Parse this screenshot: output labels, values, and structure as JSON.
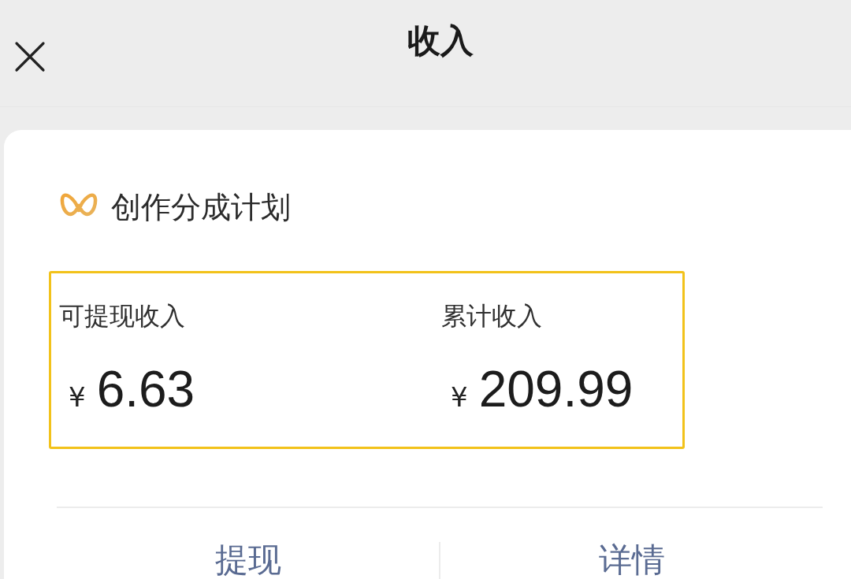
{
  "header": {
    "title": "收入"
  },
  "program": {
    "name": "创作分成计划"
  },
  "earnings": {
    "highlighted": true,
    "items": [
      {
        "label": "可提现收入",
        "currency": "¥",
        "amount": "6.63"
      },
      {
        "label": "累计收入",
        "currency": "¥",
        "amount": "209.99"
      }
    ]
  },
  "actions": [
    "提现",
    "详情"
  ]
}
